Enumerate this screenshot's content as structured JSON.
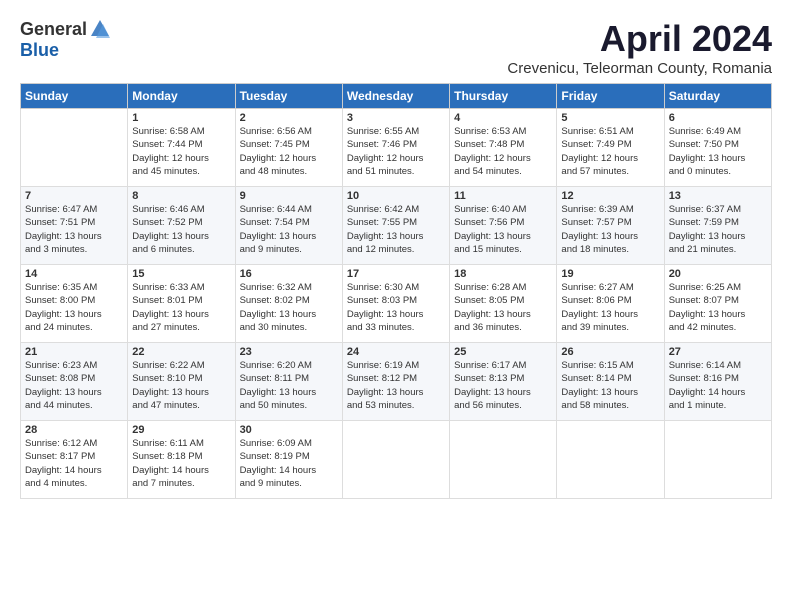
{
  "header": {
    "logo_general": "General",
    "logo_blue": "Blue",
    "title": "April 2024",
    "subtitle": "Crevenicu, Teleorman County, Romania"
  },
  "days_of_week": [
    "Sunday",
    "Monday",
    "Tuesday",
    "Wednesday",
    "Thursday",
    "Friday",
    "Saturday"
  ],
  "weeks": [
    [
      {
        "day": "",
        "info": ""
      },
      {
        "day": "1",
        "info": "Sunrise: 6:58 AM\nSunset: 7:44 PM\nDaylight: 12 hours\nand 45 minutes."
      },
      {
        "day": "2",
        "info": "Sunrise: 6:56 AM\nSunset: 7:45 PM\nDaylight: 12 hours\nand 48 minutes."
      },
      {
        "day": "3",
        "info": "Sunrise: 6:55 AM\nSunset: 7:46 PM\nDaylight: 12 hours\nand 51 minutes."
      },
      {
        "day": "4",
        "info": "Sunrise: 6:53 AM\nSunset: 7:48 PM\nDaylight: 12 hours\nand 54 minutes."
      },
      {
        "day": "5",
        "info": "Sunrise: 6:51 AM\nSunset: 7:49 PM\nDaylight: 12 hours\nand 57 minutes."
      },
      {
        "day": "6",
        "info": "Sunrise: 6:49 AM\nSunset: 7:50 PM\nDaylight: 13 hours\nand 0 minutes."
      }
    ],
    [
      {
        "day": "7",
        "info": "Sunrise: 6:47 AM\nSunset: 7:51 PM\nDaylight: 13 hours\nand 3 minutes."
      },
      {
        "day": "8",
        "info": "Sunrise: 6:46 AM\nSunset: 7:52 PM\nDaylight: 13 hours\nand 6 minutes."
      },
      {
        "day": "9",
        "info": "Sunrise: 6:44 AM\nSunset: 7:54 PM\nDaylight: 13 hours\nand 9 minutes."
      },
      {
        "day": "10",
        "info": "Sunrise: 6:42 AM\nSunset: 7:55 PM\nDaylight: 13 hours\nand 12 minutes."
      },
      {
        "day": "11",
        "info": "Sunrise: 6:40 AM\nSunset: 7:56 PM\nDaylight: 13 hours\nand 15 minutes."
      },
      {
        "day": "12",
        "info": "Sunrise: 6:39 AM\nSunset: 7:57 PM\nDaylight: 13 hours\nand 18 minutes."
      },
      {
        "day": "13",
        "info": "Sunrise: 6:37 AM\nSunset: 7:59 PM\nDaylight: 13 hours\nand 21 minutes."
      }
    ],
    [
      {
        "day": "14",
        "info": "Sunrise: 6:35 AM\nSunset: 8:00 PM\nDaylight: 13 hours\nand 24 minutes."
      },
      {
        "day": "15",
        "info": "Sunrise: 6:33 AM\nSunset: 8:01 PM\nDaylight: 13 hours\nand 27 minutes."
      },
      {
        "day": "16",
        "info": "Sunrise: 6:32 AM\nSunset: 8:02 PM\nDaylight: 13 hours\nand 30 minutes."
      },
      {
        "day": "17",
        "info": "Sunrise: 6:30 AM\nSunset: 8:03 PM\nDaylight: 13 hours\nand 33 minutes."
      },
      {
        "day": "18",
        "info": "Sunrise: 6:28 AM\nSunset: 8:05 PM\nDaylight: 13 hours\nand 36 minutes."
      },
      {
        "day": "19",
        "info": "Sunrise: 6:27 AM\nSunset: 8:06 PM\nDaylight: 13 hours\nand 39 minutes."
      },
      {
        "day": "20",
        "info": "Sunrise: 6:25 AM\nSunset: 8:07 PM\nDaylight: 13 hours\nand 42 minutes."
      }
    ],
    [
      {
        "day": "21",
        "info": "Sunrise: 6:23 AM\nSunset: 8:08 PM\nDaylight: 13 hours\nand 44 minutes."
      },
      {
        "day": "22",
        "info": "Sunrise: 6:22 AM\nSunset: 8:10 PM\nDaylight: 13 hours\nand 47 minutes."
      },
      {
        "day": "23",
        "info": "Sunrise: 6:20 AM\nSunset: 8:11 PM\nDaylight: 13 hours\nand 50 minutes."
      },
      {
        "day": "24",
        "info": "Sunrise: 6:19 AM\nSunset: 8:12 PM\nDaylight: 13 hours\nand 53 minutes."
      },
      {
        "day": "25",
        "info": "Sunrise: 6:17 AM\nSunset: 8:13 PM\nDaylight: 13 hours\nand 56 minutes."
      },
      {
        "day": "26",
        "info": "Sunrise: 6:15 AM\nSunset: 8:14 PM\nDaylight: 13 hours\nand 58 minutes."
      },
      {
        "day": "27",
        "info": "Sunrise: 6:14 AM\nSunset: 8:16 PM\nDaylight: 14 hours\nand 1 minute."
      }
    ],
    [
      {
        "day": "28",
        "info": "Sunrise: 6:12 AM\nSunset: 8:17 PM\nDaylight: 14 hours\nand 4 minutes."
      },
      {
        "day": "29",
        "info": "Sunrise: 6:11 AM\nSunset: 8:18 PM\nDaylight: 14 hours\nand 7 minutes."
      },
      {
        "day": "30",
        "info": "Sunrise: 6:09 AM\nSunset: 8:19 PM\nDaylight: 14 hours\nand 9 minutes."
      },
      {
        "day": "",
        "info": ""
      },
      {
        "day": "",
        "info": ""
      },
      {
        "day": "",
        "info": ""
      },
      {
        "day": "",
        "info": ""
      }
    ]
  ]
}
